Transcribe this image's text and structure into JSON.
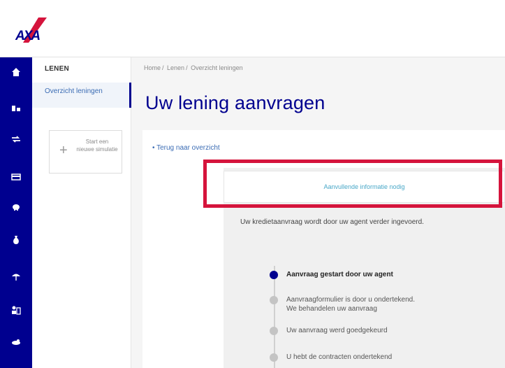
{
  "brand": {
    "logo_text": "AXA",
    "primary_color": "#00008f",
    "accent_color": "#d5143c"
  },
  "rail": {
    "icons": [
      "home-icon",
      "accounts-icon",
      "transfer-icon",
      "card-icon",
      "piggy-bank-icon",
      "loan-icon",
      "insurance-icon",
      "contacts-icon",
      "investments-icon"
    ]
  },
  "subnav": {
    "title": "LENEN",
    "active_item": "Overzicht leningen",
    "simulation_card": {
      "label": "Start een nieuwe simulatie"
    }
  },
  "breadcrumb": [
    "Home",
    "Lenen",
    "Overzicht leningen"
  ],
  "page": {
    "title": "Uw lening aanvragen"
  },
  "content": {
    "back_link": "• Terug naar overzicht",
    "notice": "Aanvullende informatie nodig",
    "info_text": "Uw kredietaanvraag wordt door uw agent verder ingevoerd.",
    "steps": [
      {
        "line1": "Aanvraag gestart door uw agent",
        "line2": "",
        "active": true
      },
      {
        "line1": "Aanvraagformulier is door u ondertekend.",
        "line2": "We behandelen uw aanvraag",
        "active": false
      },
      {
        "line1": "Uw aanvraag werd goedgekeurd",
        "line2": "",
        "active": false
      },
      {
        "line1": "U hebt de contracten ondertekend",
        "line2": "",
        "active": false
      }
    ]
  }
}
